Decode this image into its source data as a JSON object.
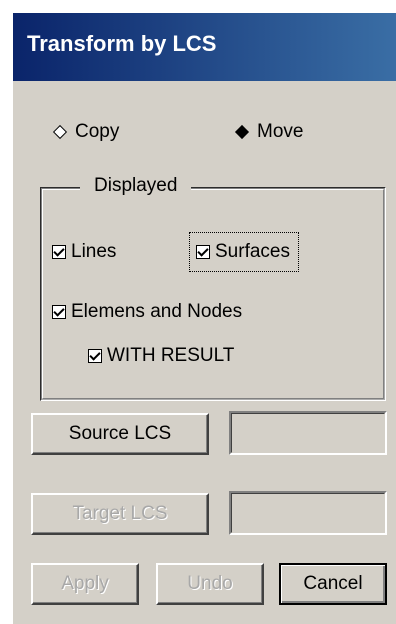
{
  "window": {
    "title": "Transform by LCS"
  },
  "mode": {
    "copy_label": "Copy",
    "move_label": "Move",
    "selected": "Move"
  },
  "displayed": {
    "legend": "Displayed",
    "lines_label": "Lines",
    "surfaces_label": "Surfaces",
    "elements_label": "Elemens and Nodes",
    "with_result_label": "WITH RESULT",
    "lines_checked": true,
    "surfaces_checked": true,
    "elements_checked": true,
    "with_result_checked": true
  },
  "source": {
    "button_label": "Source LCS",
    "value": ""
  },
  "target": {
    "button_label": "Target LCS",
    "value": ""
  },
  "actions": {
    "apply_label": "Apply",
    "undo_label": "Undo",
    "cancel_label": "Cancel"
  }
}
